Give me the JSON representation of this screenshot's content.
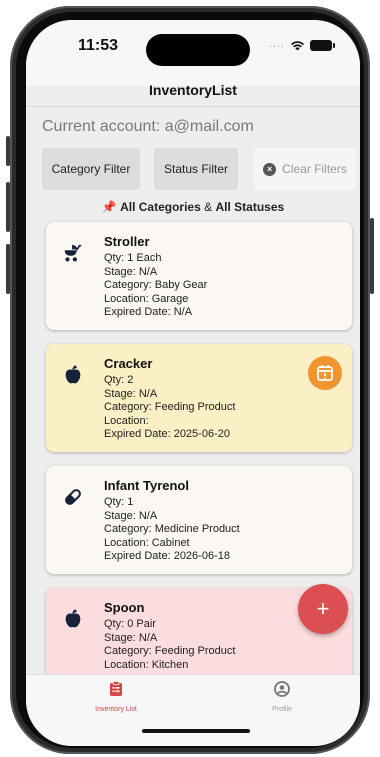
{
  "status_bar": {
    "time": "11:53",
    "signal": "....",
    "wifi_icon": "wifi-icon",
    "battery_icon": "battery-icon"
  },
  "nav": {
    "title": "InventoryList"
  },
  "account": {
    "text": "Current account: a@mail.com"
  },
  "filters": {
    "category_label": "Category Filter",
    "status_label": "Status Filter",
    "clear_label": "Clear Filters"
  },
  "summary": {
    "pin_icon": "pushpin-icon",
    "all_categories": "All Categories",
    "amp": "&",
    "all_statuses": "All Statuses"
  },
  "colors": {
    "card_default": "#fbf8f3",
    "card_expiring": "#fbefc5",
    "card_out_of_stock": "#fbdcdf",
    "badge_orange": "#f0942f",
    "fab_red": "#db4f52",
    "tab_active": "#d64545",
    "tab_inactive": "#9a9a9a"
  },
  "items": [
    {
      "name": "Stroller",
      "icon": "baby-carriage-icon",
      "qty": "Qty: 1 Each",
      "stage": "Stage: N/A",
      "category": "Category: Baby Gear",
      "location": "Location: Garage",
      "expired": "Expired Date: N/A"
    },
    {
      "name": "Cracker",
      "icon": "apple-icon",
      "qty": "Qty: 2",
      "stage": "Stage: N/A",
      "category": "Category: Feeding Product",
      "location": "Location:",
      "expired": "Expired Date: 2025-06-20",
      "badge_icon": "calendar-alert-icon"
    },
    {
      "name": "Infant Tyrenol",
      "icon": "pill-icon",
      "qty": "Qty: 1",
      "stage": "Stage: N/A",
      "category": "Category: Medicine Product",
      "location": "Location: Cabinet",
      "expired": "Expired Date: 2026-06-18"
    },
    {
      "name": "Spoon",
      "icon": "apple-icon",
      "qty": "Qty: 0 Pair",
      "stage": "Stage: N/A",
      "category": "Category: Feeding Product",
      "location": "Location: Kitchen"
    }
  ],
  "fab": {
    "label": "+"
  },
  "tabs": [
    {
      "label": "Inventory List",
      "icon": "clipboard-list-icon",
      "active": true
    },
    {
      "label": "Profile",
      "icon": "user-circle-icon",
      "active": false
    }
  ]
}
